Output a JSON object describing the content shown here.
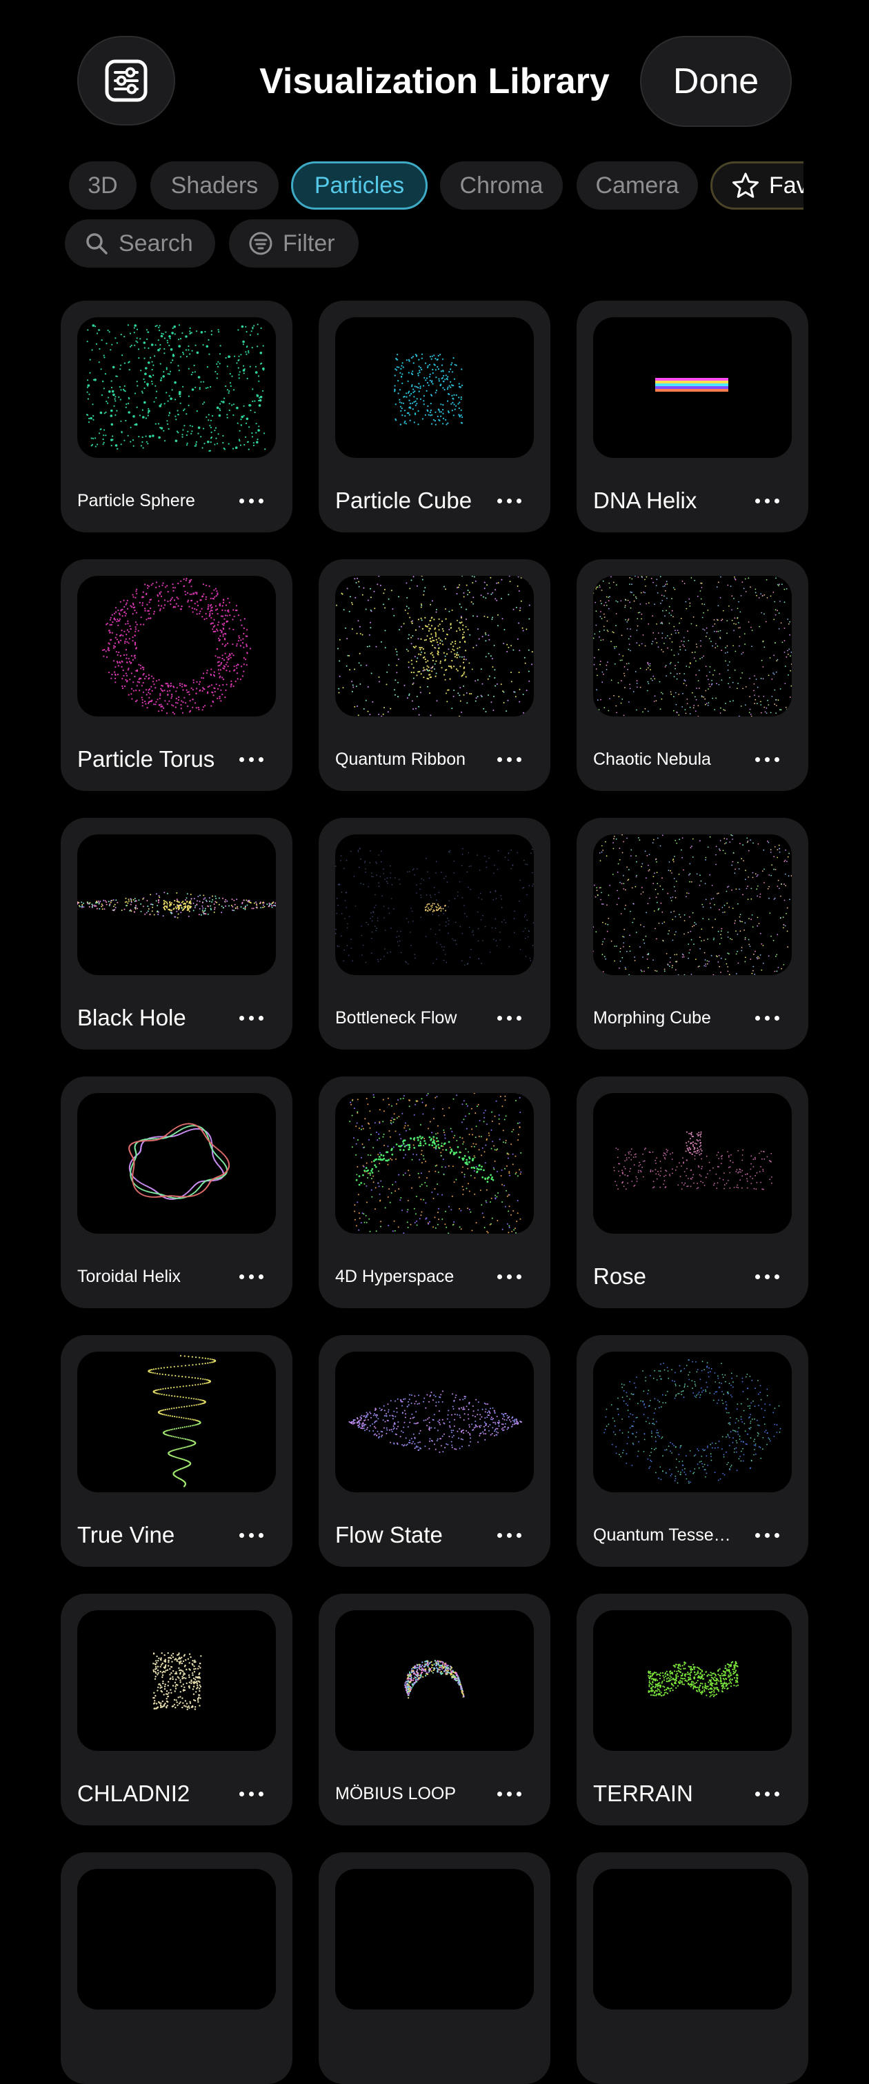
{
  "header": {
    "title": "Visualization Library",
    "done_label": "Done"
  },
  "tabs": [
    {
      "label": "3D",
      "active": false
    },
    {
      "label": "Shaders",
      "active": false
    },
    {
      "label": "Particles",
      "active": true
    },
    {
      "label": "Chroma",
      "active": false
    },
    {
      "label": "Camera",
      "active": false
    },
    {
      "label": "Favorites",
      "active": false
    }
  ],
  "tools": {
    "search_label": "Search",
    "filter_label": "Filter"
  },
  "cards": [
    {
      "label": "Particle Sphere",
      "size": "small",
      "icon": "particle-sphere-preview"
    },
    {
      "label": "Particle Cube",
      "size": "big",
      "icon": "particle-cube-preview"
    },
    {
      "label": "DNA Helix",
      "size": "big",
      "icon": "dna-helix-preview"
    },
    {
      "label": "Particle Torus",
      "size": "big",
      "icon": "particle-torus-preview"
    },
    {
      "label": "Quantum Ribbon",
      "size": "small",
      "icon": "quantum-ribbon-preview"
    },
    {
      "label": "Chaotic Nebula",
      "size": "small",
      "icon": "chaotic-nebula-preview"
    },
    {
      "label": "Black Hole",
      "size": "big",
      "icon": "black-hole-preview"
    },
    {
      "label": "Bottleneck Flow",
      "size": "small",
      "icon": "bottleneck-flow-preview"
    },
    {
      "label": "Morphing Cube",
      "size": "small",
      "icon": "morphing-cube-preview"
    },
    {
      "label": "Toroidal Helix",
      "size": "small",
      "icon": "toroidal-helix-preview"
    },
    {
      "label": "4D Hyperspace",
      "size": "small",
      "icon": "hyperspace-preview"
    },
    {
      "label": "Rose",
      "size": "big",
      "icon": "rose-preview"
    },
    {
      "label": "True Vine",
      "size": "big",
      "icon": "true-vine-preview"
    },
    {
      "label": "Flow State",
      "size": "big",
      "icon": "flow-state-preview"
    },
    {
      "label": "Quantum Tesse…",
      "size": "small",
      "icon": "quantum-tesseract-preview"
    },
    {
      "label": "CHLADNI2",
      "size": "big",
      "icon": "chladni-preview"
    },
    {
      "label": "MÖBIUS LOOP",
      "size": "small",
      "icon": "mobius-loop-preview"
    },
    {
      "label": "TERRAIN",
      "size": "big",
      "icon": "terrain-preview"
    }
  ],
  "colors": {
    "background": "#000000",
    "card": "#1c1c1e",
    "accent": "#56c9e8",
    "chip_text": "#8e8e93"
  }
}
